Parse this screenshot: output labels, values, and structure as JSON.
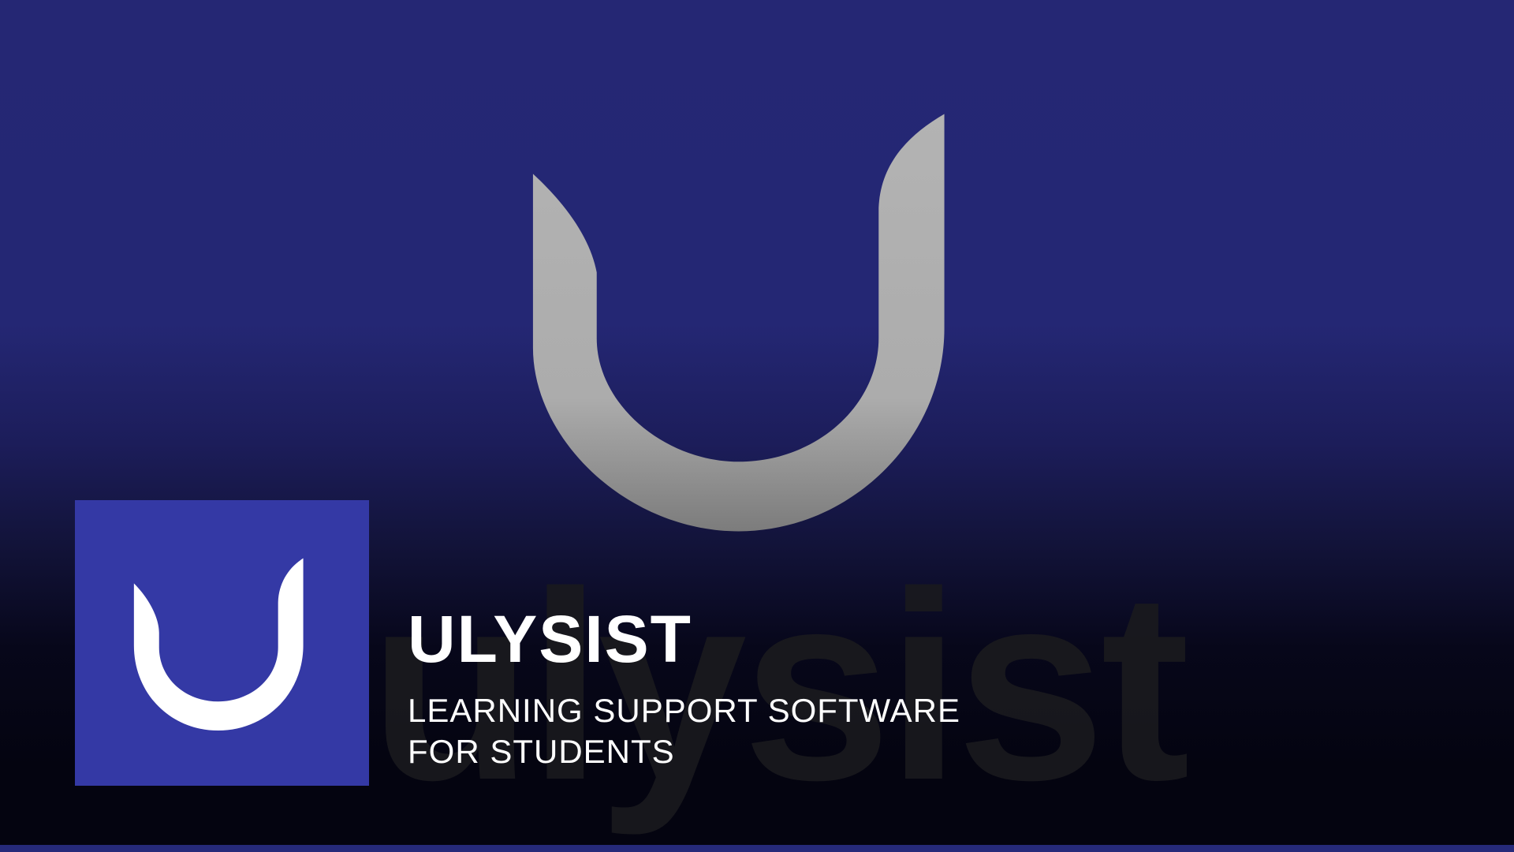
{
  "brand": {
    "title": "ULYSIST",
    "tagline_line1": "LEARNING SUPPORT SOFTWARE",
    "tagline_line2": "FOR STUDENTS",
    "watermark_word": "ulysist"
  },
  "colors": {
    "background_top": "#252774",
    "background_bottom": "#040410",
    "tile": "#3439a5",
    "large_logo": "#b0b0b0",
    "bottom_bar": "#262a7a"
  }
}
